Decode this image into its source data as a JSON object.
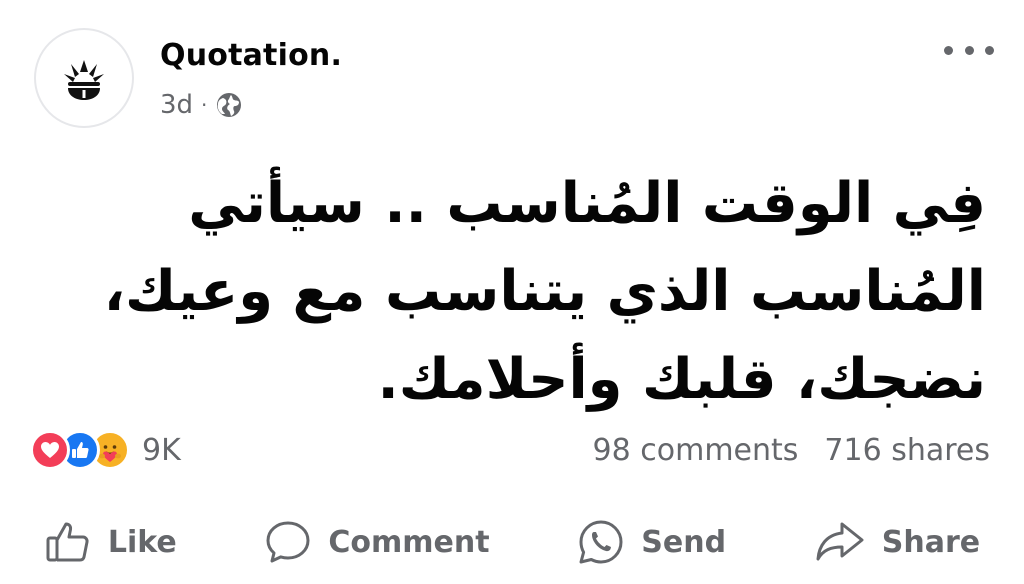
{
  "page": {
    "author": "Quotation.",
    "time": "3d",
    "separator": "·",
    "privacy_icon": "globe-icon"
  },
  "post": {
    "lines": [
      "فِي الوقت المُناسب .. سيأتي",
      "المُناسب الذي يتناسب مع وعيك،",
      "نضجك، قلبك وأحلامك."
    ]
  },
  "stats": {
    "reactions": [
      "love",
      "like",
      "care"
    ],
    "reaction_count": "9K",
    "comments": "98 comments",
    "shares": "716 shares"
  },
  "actions": {
    "like": "Like",
    "comment": "Comment",
    "send": "Send",
    "share": "Share"
  },
  "colors": {
    "like_blue": "#1877f2",
    "love_red": "#f33e58",
    "care_yellow": "#f7b125",
    "secondary_text": "#65676b"
  }
}
